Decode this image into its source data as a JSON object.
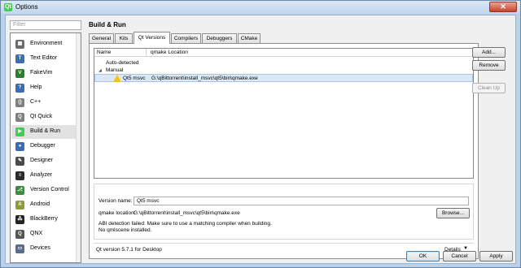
{
  "window": {
    "title": "Options",
    "app_icon_glyph": "Qt",
    "close_glyph": "✕"
  },
  "sidebar": {
    "filter_placeholder": "Filter",
    "items": [
      {
        "label": "Environment",
        "icon": "environment-icon",
        "color": "#6d6d6d",
        "glyph": "▦"
      },
      {
        "label": "Text Editor",
        "icon": "text-editor-icon",
        "color": "#3a6fb0",
        "glyph": "T"
      },
      {
        "label": "FakeVim",
        "icon": "fakevim-icon",
        "color": "#2e7d32",
        "glyph": "V"
      },
      {
        "label": "Help",
        "icon": "help-icon",
        "color": "#3e6bb3",
        "glyph": "?"
      },
      {
        "label": "C++",
        "icon": "cpp-icon",
        "color": "#7f7f7f",
        "glyph": "{}"
      },
      {
        "label": "Qt Quick",
        "icon": "qt-quick-icon",
        "color": "#7f7f7f",
        "glyph": "Q"
      },
      {
        "label": "Build & Run",
        "icon": "build-run-icon",
        "color": "#41cd52",
        "glyph": "▶"
      },
      {
        "label": "Debugger",
        "icon": "debugger-icon",
        "color": "#3f6ab5",
        "glyph": "●"
      },
      {
        "label": "Designer",
        "icon": "designer-icon",
        "color": "#4a4a4a",
        "glyph": "✎"
      },
      {
        "label": "Analyzer",
        "icon": "analyzer-icon",
        "color": "#2b2b2b",
        "glyph": "≡"
      },
      {
        "label": "Version Control",
        "icon": "version-control-icon",
        "color": "#3b8c3b",
        "glyph": "⎇"
      },
      {
        "label": "Android",
        "icon": "android-icon",
        "color": "#8b9c3c",
        "glyph": "A"
      },
      {
        "label": "BlackBerry",
        "icon": "blackberry-icon",
        "color": "#222222",
        "glyph": "⁂"
      },
      {
        "label": "QNX",
        "icon": "qnx-icon",
        "color": "#555555",
        "glyph": "Q"
      },
      {
        "label": "Devices",
        "icon": "devices-icon",
        "color": "#5a6e8c",
        "glyph": "▭"
      }
    ],
    "selected_index": 6
  },
  "page": {
    "title": "Build & Run"
  },
  "tabs": [
    "General",
    "Kits",
    "Qt Versions",
    "Compilers",
    "Debuggers",
    "CMake"
  ],
  "active_tab": "Qt Versions",
  "tree": {
    "columns": [
      "Name",
      "qmake Location"
    ],
    "auto_detected_label": "Auto-detected",
    "manual_label": "Manual",
    "expand_glyph": "◢",
    "entry": {
      "name": "Qt5 msvc",
      "location": "G:\\qBittorrent\\install_msvc\\qt5\\bin\\qmake.exe"
    }
  },
  "buttons": {
    "add": "Add...",
    "remove": "Remove",
    "cleanup": "Clean Up",
    "browse": "Browse...",
    "details": "Details",
    "details_arrow": "▼",
    "ok": "OK",
    "cancel": "Cancel",
    "apply": "Apply"
  },
  "details": {
    "version_name_label": "Version name:",
    "version_name_value": "Qt5 msvc",
    "qmake_location_label": "qmake location:",
    "qmake_location_value": "G:\\qBittorrent\\install_msvc\\qt5\\bin\\qmake.exe",
    "abi_error_line1": "ABI detection failed: Make sure to use a matching compiler when building.",
    "abi_error_line2": "No qmlscene installed."
  },
  "status": {
    "version_text": "Qt version 5.7.1 for Desktop"
  },
  "colors": {
    "warning": "#f5c211",
    "selection": "#dbe8f5",
    "qt_green": "#41cd52"
  }
}
